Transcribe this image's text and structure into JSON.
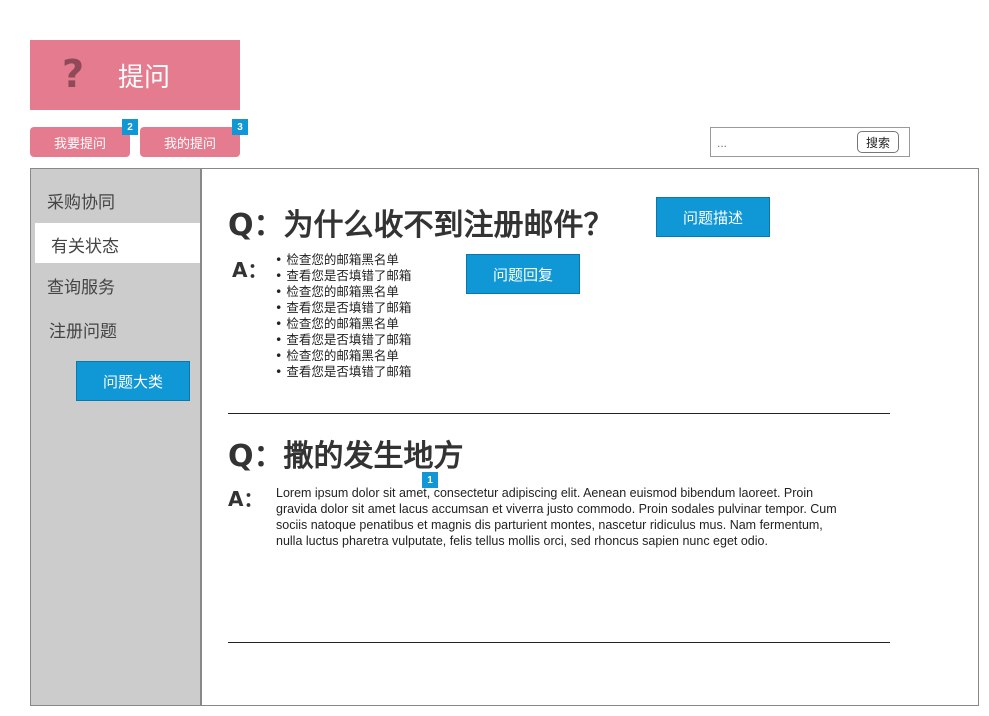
{
  "header": {
    "logo_icon": "question-mark-icon",
    "logo_glyph": "?",
    "title": "提问",
    "colors": {
      "brand_pink": "#e57b8e",
      "accent_blue": "#0f97d6",
      "sidebar_gray": "#cccccc"
    }
  },
  "actions": {
    "ask_label": "我要提问",
    "ask_badge": "2",
    "my_questions_label": "我的提问",
    "my_questions_badge": "3"
  },
  "search": {
    "placeholder": "...",
    "button_label": "搜索"
  },
  "sidebar": {
    "items": [
      {
        "label": "采购协同"
      },
      {
        "label": "有关状态",
        "active": true
      },
      {
        "label": "查询服务"
      },
      {
        "label": "注册问题"
      }
    ],
    "category_button": "问题大类"
  },
  "faq": [
    {
      "question": "Q：为什么收不到注册邮件？",
      "answer_label": "A：",
      "describe_button": "问题描述",
      "reply_button": "问题回复",
      "answer_items": [
        "检查您的邮箱黑名单",
        "查看您是否填错了邮箱",
        "检查您的邮箱黑名单",
        "查看您是否填错了邮箱",
        "检查您的邮箱黑名单",
        "查看您是否填错了邮箱",
        "检查您的邮箱黑名单",
        "查看您是否填错了邮箱"
      ]
    },
    {
      "question": "Q：撒的发生地方",
      "answer_label": "A：",
      "badge": "1",
      "answer_text": "Lorem ipsum dolor sit amet, consectetur adipiscing elit. Aenean euismod bibendum laoreet. Proin gravida dolor sit amet lacus accumsan et viverra justo commodo. Proin sodales pulvinar tempor. Cum sociis natoque penatibus et magnis dis parturient montes, nascetur ridiculus mus. Nam fermentum, nulla luctus pharetra vulputate, felis tellus mollis orci, sed rhoncus sapien nunc eget odio."
    }
  ]
}
